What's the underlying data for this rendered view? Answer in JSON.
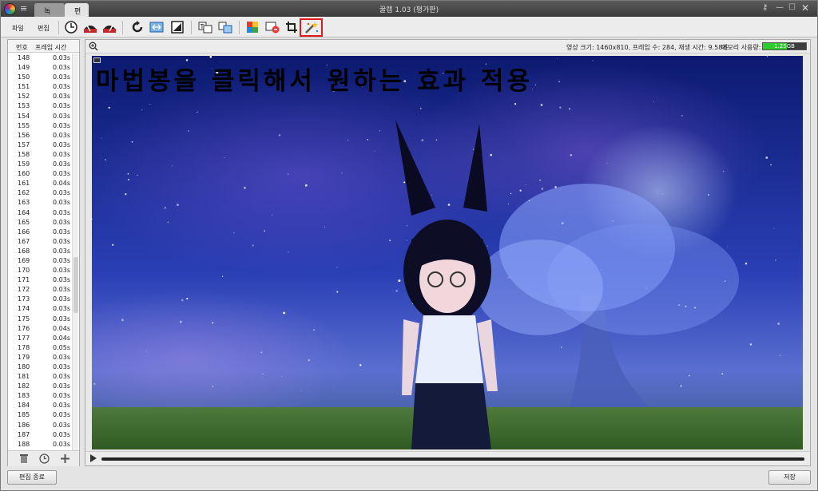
{
  "window": {
    "title": "꿀캠 1.03 (평가판)",
    "tabs": [
      {
        "label": "녹화"
      },
      {
        "label": "편집"
      }
    ]
  },
  "menu": {
    "file": "파일",
    "edit": "편집"
  },
  "list": {
    "col_no": "번호",
    "col_time": "프레임 시간",
    "rows": [
      {
        "n": "148",
        "t": "0.03s"
      },
      {
        "n": "149",
        "t": "0.03s"
      },
      {
        "n": "150",
        "t": "0.03s"
      },
      {
        "n": "151",
        "t": "0.03s"
      },
      {
        "n": "152",
        "t": "0.03s"
      },
      {
        "n": "153",
        "t": "0.03s"
      },
      {
        "n": "154",
        "t": "0.03s"
      },
      {
        "n": "155",
        "t": "0.03s"
      },
      {
        "n": "156",
        "t": "0.03s"
      },
      {
        "n": "157",
        "t": "0.03s"
      },
      {
        "n": "158",
        "t": "0.03s"
      },
      {
        "n": "159",
        "t": "0.03s"
      },
      {
        "n": "160",
        "t": "0.03s"
      },
      {
        "n": "161",
        "t": "0.04s"
      },
      {
        "n": "162",
        "t": "0.03s"
      },
      {
        "n": "163",
        "t": "0.03s"
      },
      {
        "n": "164",
        "t": "0.03s"
      },
      {
        "n": "165",
        "t": "0.03s"
      },
      {
        "n": "166",
        "t": "0.03s"
      },
      {
        "n": "167",
        "t": "0.03s"
      },
      {
        "n": "168",
        "t": "0.03s"
      },
      {
        "n": "169",
        "t": "0.03s"
      },
      {
        "n": "170",
        "t": "0.03s"
      },
      {
        "n": "171",
        "t": "0.03s"
      },
      {
        "n": "172",
        "t": "0.03s"
      },
      {
        "n": "173",
        "t": "0.03s"
      },
      {
        "n": "174",
        "t": "0.03s"
      },
      {
        "n": "175",
        "t": "0.03s"
      },
      {
        "n": "176",
        "t": "0.04s"
      },
      {
        "n": "177",
        "t": "0.04s"
      },
      {
        "n": "178",
        "t": "0.05s"
      },
      {
        "n": "179",
        "t": "0.03s"
      },
      {
        "n": "180",
        "t": "0.03s"
      },
      {
        "n": "181",
        "t": "0.03s"
      },
      {
        "n": "182",
        "t": "0.03s"
      },
      {
        "n": "183",
        "t": "0.03s"
      },
      {
        "n": "184",
        "t": "0.03s"
      },
      {
        "n": "185",
        "t": "0.03s"
      },
      {
        "n": "186",
        "t": "0.03s"
      },
      {
        "n": "187",
        "t": "0.03s"
      },
      {
        "n": "188",
        "t": "0.03s"
      }
    ]
  },
  "info": {
    "video": "영상 크기: 1460x810, 프레임 수: 284, 재생 시간: 9.58초",
    "memory_label": "메모리 사용량:",
    "memory_value": "1.25GB",
    "memory_fraction": 0.55
  },
  "preview": {
    "caption": "마법봉을 클릭해서 원하는 효과 적용"
  },
  "buttons": {
    "end": "편집 종료",
    "save": "저장"
  },
  "toolbar_icons": [
    "clock-icon",
    "speed-down-icon",
    "speed-up-icon",
    "refresh-icon",
    "resize-icon",
    "crop-frame-icon",
    "text-icon",
    "watermark-icon",
    "color-icon",
    "delete-frames-icon",
    "crop-icon",
    "magic-wand-icon"
  ],
  "colors": {
    "highlight": "#e0191d",
    "memory": "#2ecb2e"
  }
}
